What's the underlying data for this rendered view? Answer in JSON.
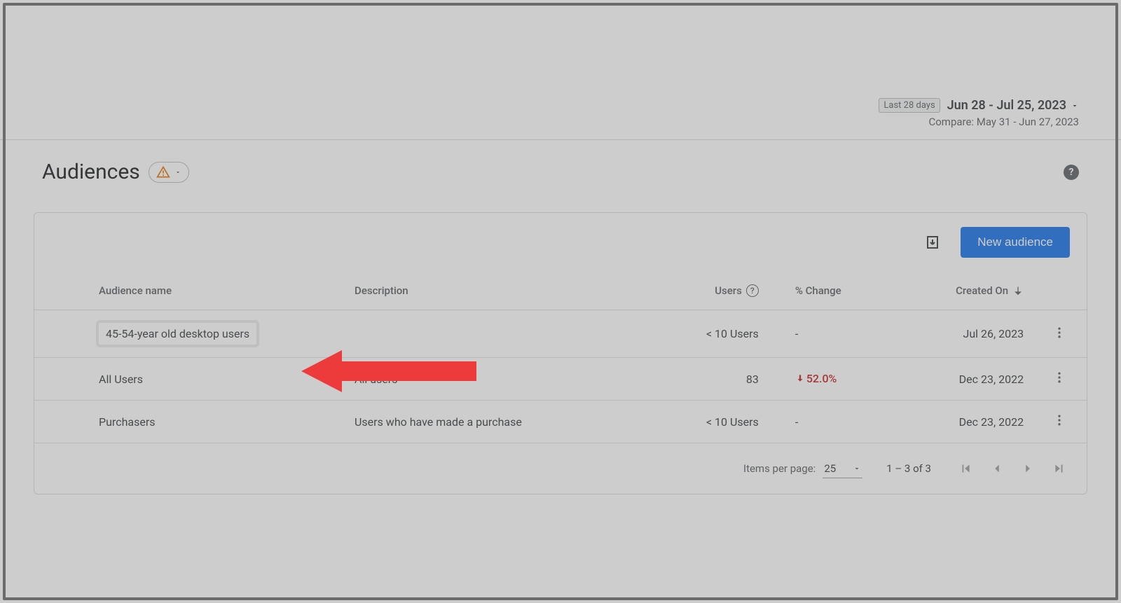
{
  "dateRange": {
    "presetLabel": "Last 28 days",
    "rangeText": "Jun 28 - Jul 25, 2023",
    "compareText": "Compare: May 31 - Jun 27, 2023"
  },
  "header": {
    "title": "Audiences"
  },
  "actions": {
    "newAudienceLabel": "New audience"
  },
  "table": {
    "columns": {
      "name": "Audience name",
      "description": "Description",
      "users": "Users",
      "change": "% Change",
      "created": "Created On"
    },
    "rows": [
      {
        "name": "45-54-year old desktop users",
        "description": "",
        "users": "< 10 Users",
        "changeText": "-",
        "changeDirection": "none",
        "created": "Jul 26, 2023",
        "highlight": true
      },
      {
        "name": "All Users",
        "description": "All users",
        "users": "83",
        "changeText": "52.0%",
        "changeDirection": "down",
        "created": "Dec 23, 2022",
        "highlight": false
      },
      {
        "name": "Purchasers",
        "description": "Users who have made a purchase",
        "users": "< 10 Users",
        "changeText": "-",
        "changeDirection": "none",
        "created": "Dec 23, 2022",
        "highlight": false
      }
    ]
  },
  "pagination": {
    "itemsPerPageLabel": "Items per page:",
    "itemsPerPageValue": "25",
    "rangeText": "1 – 3 of 3"
  }
}
